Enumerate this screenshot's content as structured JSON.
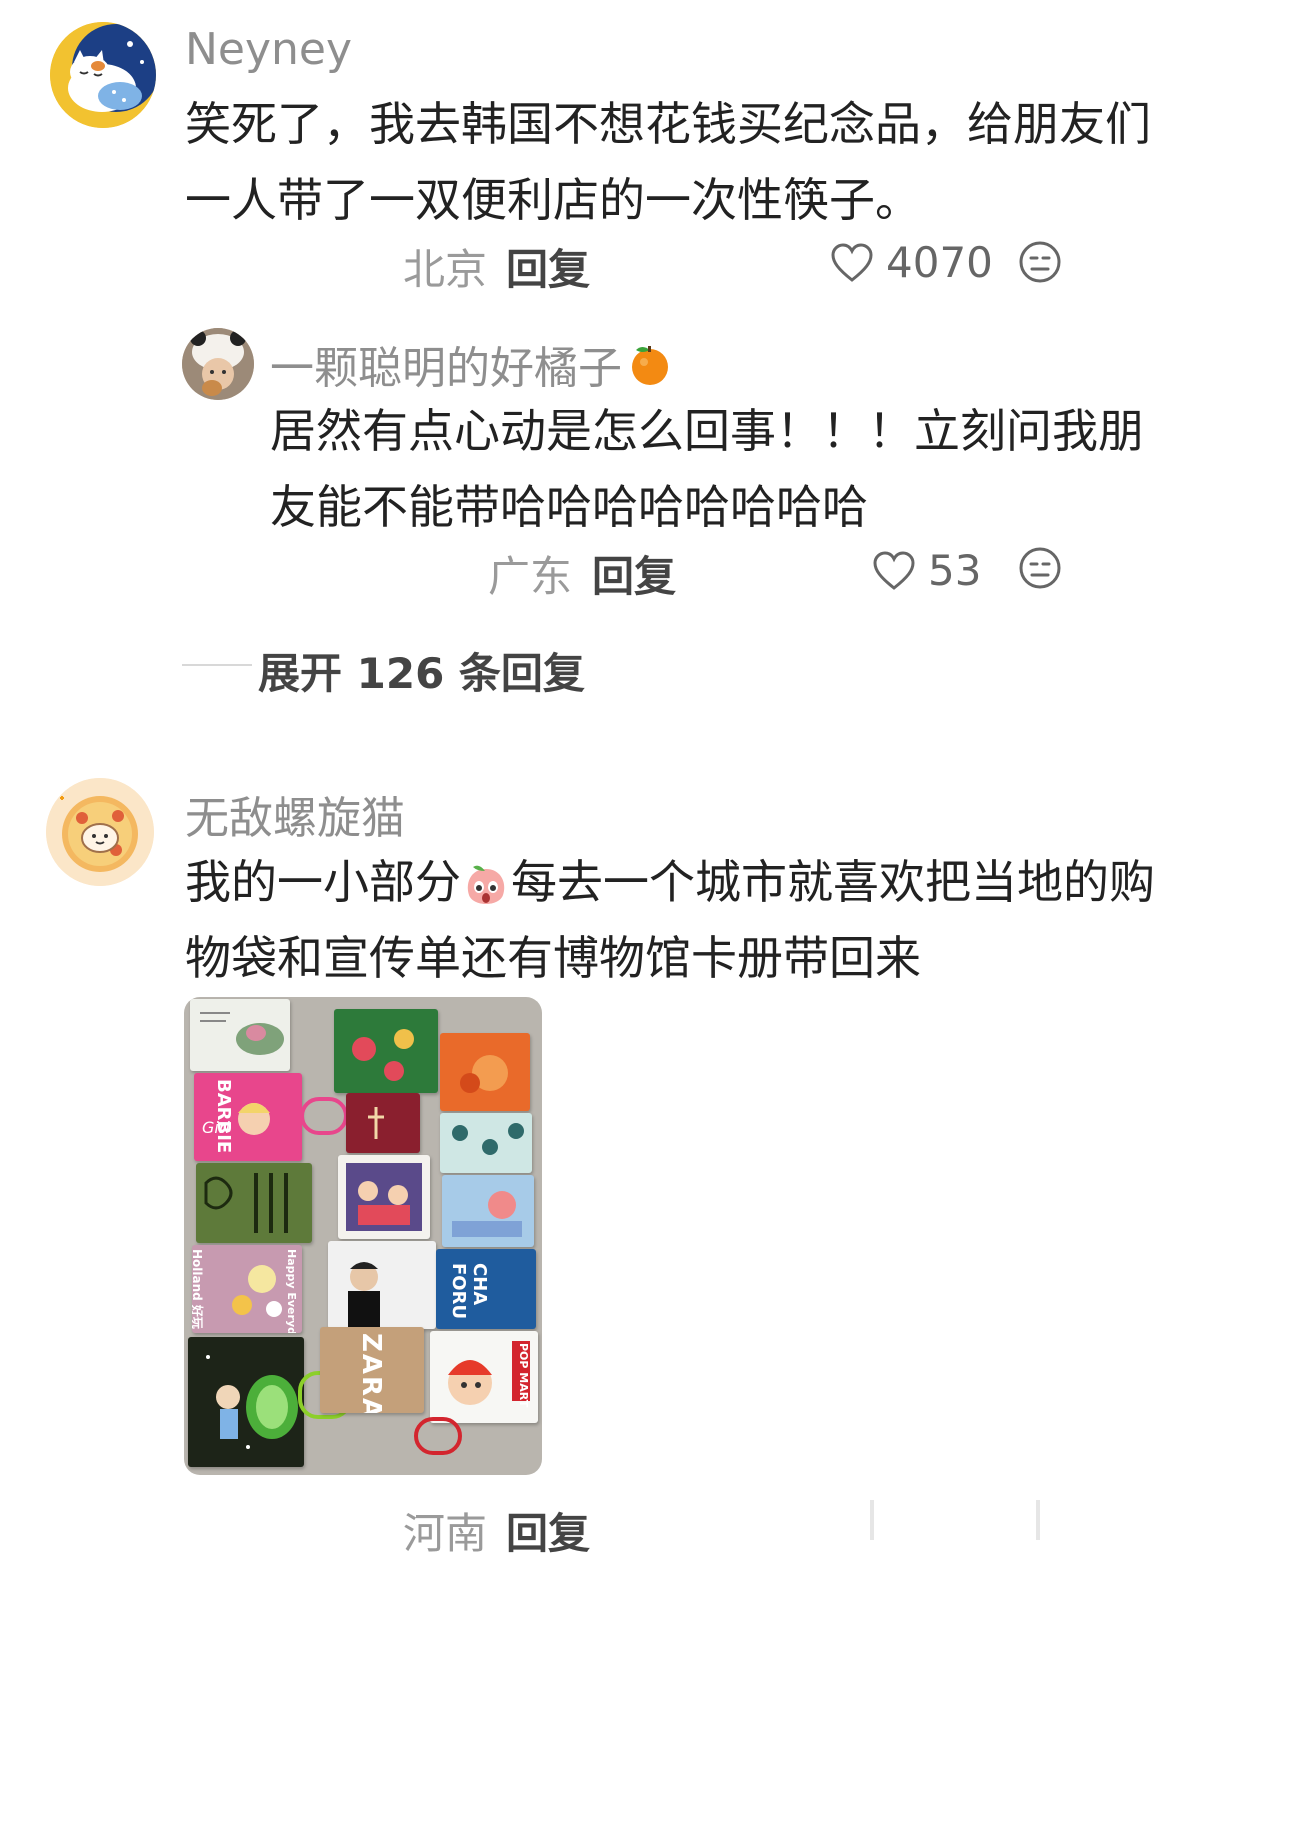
{
  "comments": [
    {
      "username": "Neyney",
      "text_lines": [
        "笑死了，我去韩国不想花钱买纪念品，给朋友们",
        "一人带了一双便利店的一次性筷子。"
      ],
      "location": "北京",
      "reply_label": "回复",
      "likes": "4070",
      "replies": [
        {
          "username": "一颗聪明的好橘子",
          "text_lines": [
            "居然有点心动是怎么回事！！！立刻问我朋",
            "友能不能带哈哈哈哈哈哈哈哈"
          ],
          "location": "广东",
          "reply_label": "回复",
          "likes": "53"
        }
      ],
      "expand_label": "展开 126 条回复"
    },
    {
      "username": "无敌螺旋猫",
      "text_before_emoji": "我的一小部分",
      "text_after_emoji": "每去一个城市就喜欢把当地的购",
      "text_line2": "物袋和宣传单还有博物馆卡册带回来",
      "location": "河南",
      "reply_label": "回复",
      "photo_labels": {
        "barbie": "BARBIE",
        "zara": "ZARA",
        "chaforu": "CHA FORU",
        "popmart": "POP MART",
        "holland": "Holland 好玩",
        "happy": "Happy Everyday"
      }
    }
  ],
  "colors": {
    "accent_orange": "#f39c12",
    "bag_pink": "#e8468c",
    "bag_blue": "#1f5c9e"
  }
}
